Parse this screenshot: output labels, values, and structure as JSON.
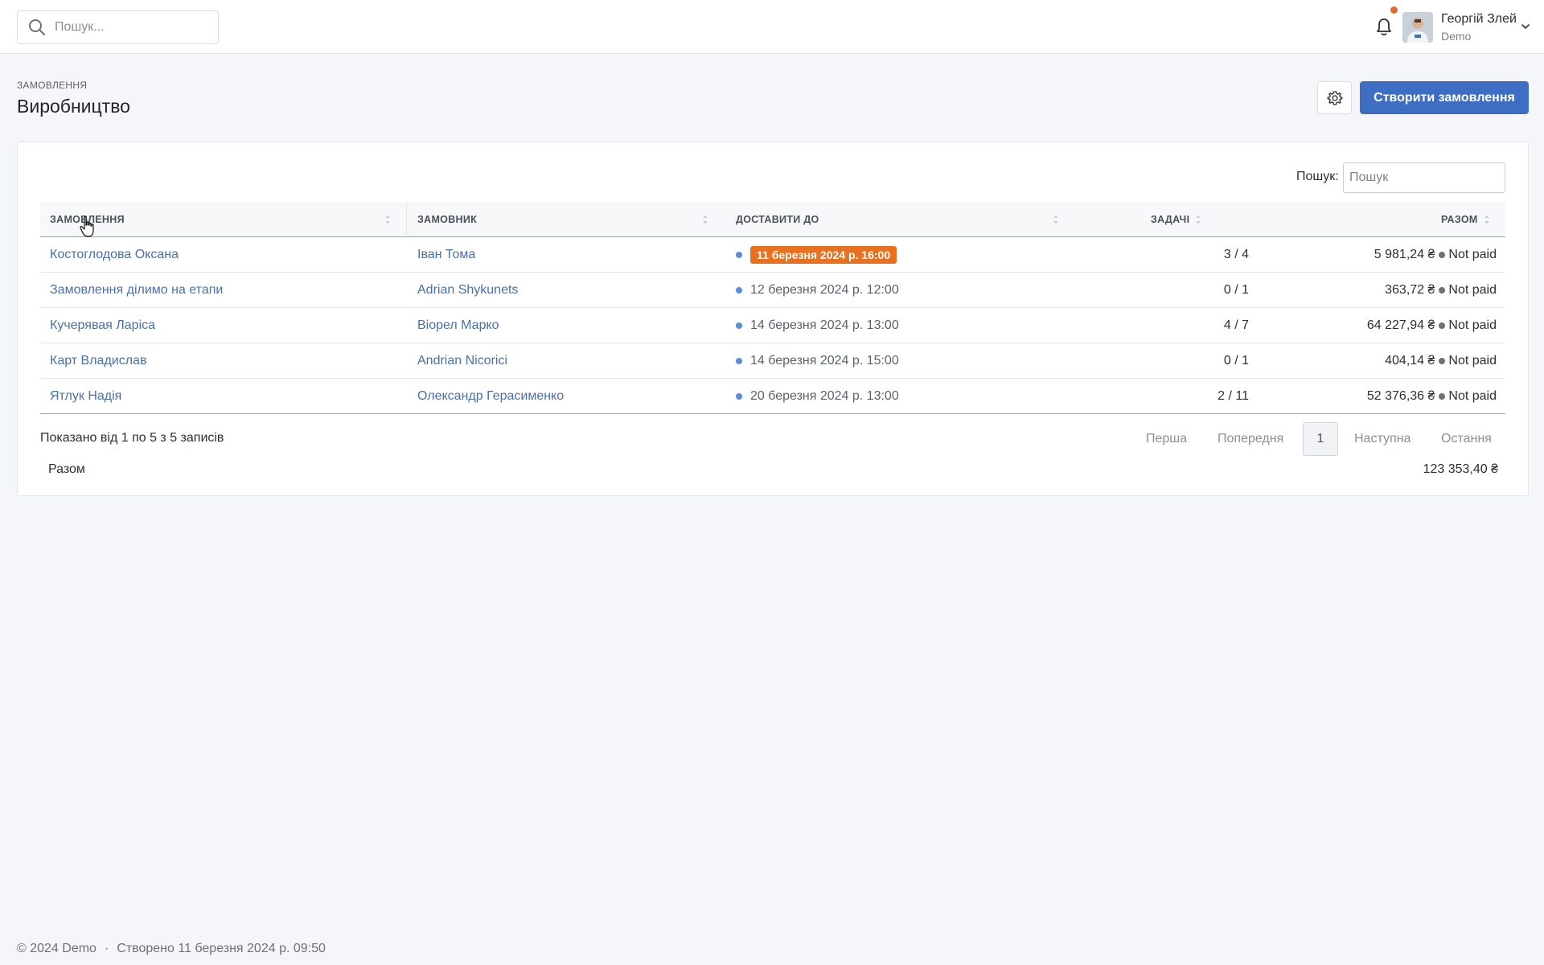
{
  "topbar": {
    "search_placeholder": "Пошук...",
    "user_name": "Георгій Злей",
    "user_role": "Demo"
  },
  "header": {
    "breadcrumb": "ЗАМОВЛЕННЯ",
    "title": "Виробництво",
    "create_button": "Створити замовлення"
  },
  "table": {
    "search_label": "Пошук:",
    "search_placeholder": "Пошук",
    "columns": {
      "order": "ЗАМОВЛЕННЯ",
      "customer": "ЗАМОВНИК",
      "deliver": "ДОСТАВИТИ ДО",
      "tasks": "ЗАДАЧІ",
      "total": "РАЗОМ"
    },
    "rows": [
      {
        "order": "Костоглодова Оксана",
        "customer": "Іван Тома",
        "deliver": "11 березня 2024 р. 16:00",
        "tasks": "3 / 4",
        "total": "5 981,24 ₴",
        "status": "Not paid"
      },
      {
        "order": "Замовлення ділимо на етапи",
        "customer": "Adrian Shykunets",
        "deliver": "12 березня 2024 р. 12:00",
        "tasks": "0 / 1",
        "total": "363,72 ₴",
        "status": "Not paid"
      },
      {
        "order": "Кучерявая Ларіса",
        "customer": "Віорел Марко",
        "deliver": "14 березня 2024 р. 13:00",
        "tasks": "4 / 7",
        "total": "64 227,94 ₴",
        "status": "Not paid"
      },
      {
        "order": "Карт Владислав",
        "customer": "Andrian Nicorici",
        "deliver": "14 березня 2024 р. 15:00",
        "tasks": "0 / 1",
        "total": "404,14 ₴",
        "status": "Not paid"
      },
      {
        "order": "Ятлук Надія",
        "customer": "Олександр Герасименко",
        "deliver": "20 березня 2024 р. 13:00",
        "tasks": "2 / 11",
        "total": "52 376,36 ₴",
        "status": "Not paid"
      }
    ],
    "info": "Показано від 1 по 5 з 5 записів",
    "pager": {
      "first": "Перша",
      "prev": "Попередня",
      "current": "1",
      "next": "Наступна",
      "last": "Остання"
    },
    "total_label": "Разом",
    "total_value": "123 353,40 ₴"
  },
  "footer": {
    "copyright": "© 2024 Demo",
    "separator": "·",
    "created": "Створено 11 березня 2024 р. 09:50"
  },
  "colors": {
    "primary": "#3e6ec4",
    "overdue": "#e8701e",
    "link": "#4a6fb0",
    "notification_dot": "#e06b2a"
  }
}
